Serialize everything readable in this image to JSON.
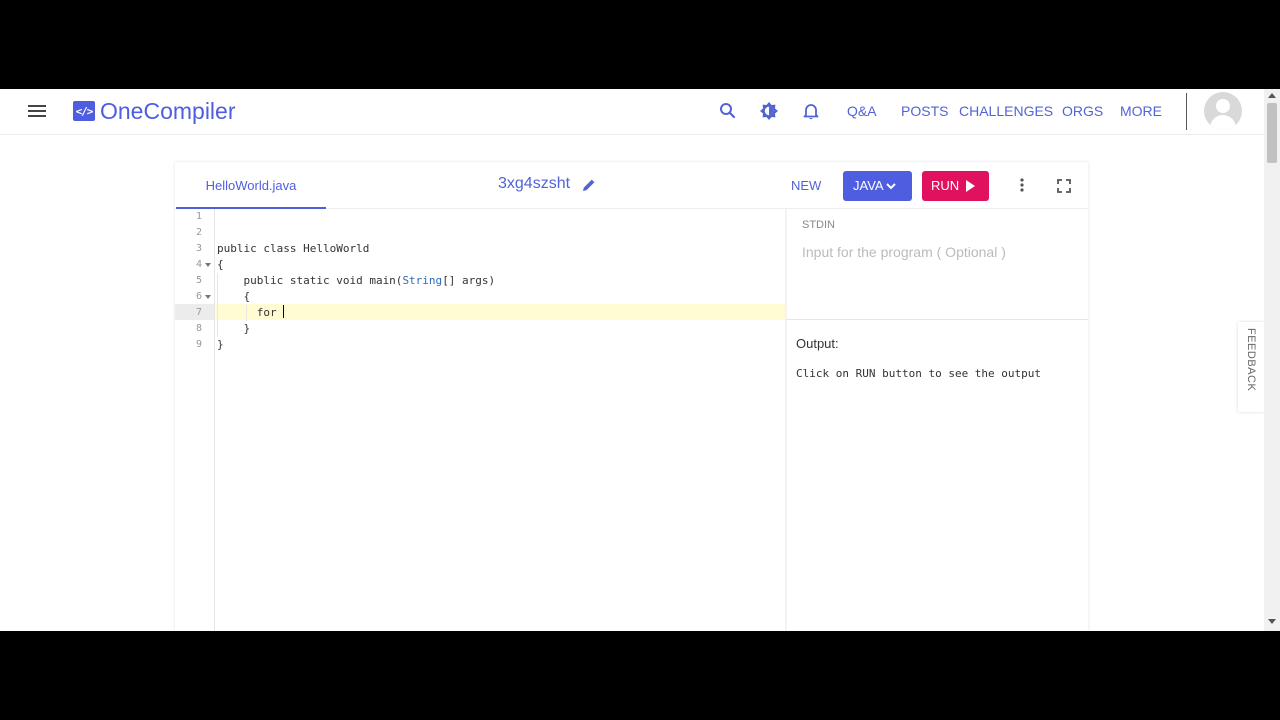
{
  "header": {
    "logo_mark": "</>",
    "logo_text": "OneCompiler",
    "nav": [
      "Q&A",
      "POSTS",
      "CHALLENGES",
      "ORGS",
      "MORE"
    ]
  },
  "toolbar": {
    "file_tab": "HelloWorld.java",
    "project_name": "3xg4szsht",
    "new_label": "NEW",
    "language": "JAVA",
    "run_label": "RUN"
  },
  "editor": {
    "line_numbers": [
      "1",
      "2",
      "3",
      "4",
      "5",
      "6",
      "7",
      "8",
      "9"
    ],
    "lines": [
      {
        "text": ""
      },
      {
        "text": ""
      },
      {
        "text": "public class HelloWorld"
      },
      {
        "text": "{"
      },
      {
        "text": "    public static void main(",
        "type": "String",
        "rest": "[] args)"
      },
      {
        "text": "    {"
      },
      {
        "text": "      for "
      },
      {
        "text": "    }"
      },
      {
        "text": "}"
      }
    ],
    "active_line": 7
  },
  "stdin": {
    "label": "STDIN",
    "placeholder": "Input for the program ( Optional )"
  },
  "output": {
    "label": "Output:",
    "text": "Click on RUN button to see the output"
  },
  "feedback_label": "FEEDBACK",
  "colors": {
    "brand": "#4f5ee0",
    "run": "#e0115f",
    "active_line": "#fffbd3"
  }
}
